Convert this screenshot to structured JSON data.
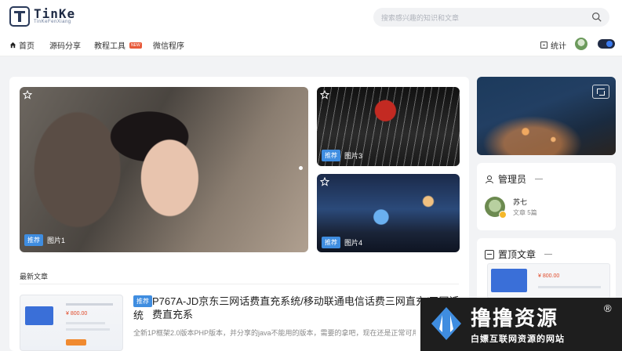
{
  "header": {
    "logo_text": "TinKe",
    "logo_sub": "TinKeFenXiang",
    "search_placeholder": "搜索感兴趣的知识和文章"
  },
  "nav": {
    "items": [
      {
        "label": "首页"
      },
      {
        "label": "源码分享"
      },
      {
        "label": "教程工具",
        "badge": "NEW"
      },
      {
        "label": "微信程序"
      }
    ],
    "stats_label": "统计"
  },
  "slider": {
    "tiles": [
      {
        "tag": "推荐",
        "caption": "图片1"
      },
      {
        "tag": "推荐",
        "caption": "图片3"
      },
      {
        "tag": "推荐",
        "caption": "图片4"
      }
    ]
  },
  "latest": {
    "section_title": "最新文章",
    "article": {
      "tag": "推荐",
      "title_line1": "P767A-JD京东三网话费直充系统/移动联通电信话费三网直充/三网话费直充系",
      "title_line2": "统",
      "excerpt": "全新1P框架2.0版本PHP版本，并分享的java不能用的版本，需要的拿吧，现在还是正常可用的",
      "thumb_price": "¥ 800.00"
    }
  },
  "sidebar": {
    "admin": {
      "heading": "管理员",
      "name": "苏七",
      "count": "文章 5篇"
    },
    "pinned": {
      "heading": "置顶文章",
      "thumb_price": "¥ 800.00"
    }
  },
  "watermark": {
    "title": "撸撸资源",
    "reg": "®",
    "subtitle": "白嫖互联网资源的网站"
  },
  "colors": {
    "accent": "#3f8de0",
    "new_badge": "#e85a3a",
    "toggle_bg": "#1f2a44",
    "toggle_knob": "#3b7bf0"
  }
}
